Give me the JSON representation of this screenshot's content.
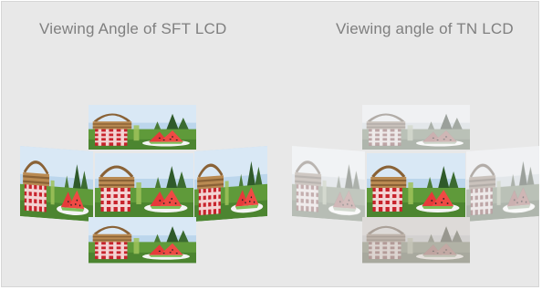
{
  "headings": {
    "sft": "Viewing Angle of SFT LCD",
    "tn": "Viewing angle of TN LCD"
  },
  "photo": {
    "subject": "picnic basket with red gingham cloth and watermelon slices on grass",
    "icon": "picnic-watermelon-photo"
  },
  "colors": {
    "background": "#e8e8e8",
    "heading_text": "#7f7f7f",
    "sky": "#bcd6ec",
    "grass": "#5f9a3a",
    "gingham_red": "#c8232c",
    "watermelon": "#e63a3a",
    "basket": "#b98a52"
  },
  "panels": {
    "sft_views": [
      "top",
      "left",
      "center",
      "right",
      "bottom"
    ],
    "tn_views": [
      "top",
      "left",
      "center",
      "right",
      "bottom"
    ],
    "tn_washed_out_views": [
      "top",
      "left",
      "right",
      "bottom"
    ]
  }
}
